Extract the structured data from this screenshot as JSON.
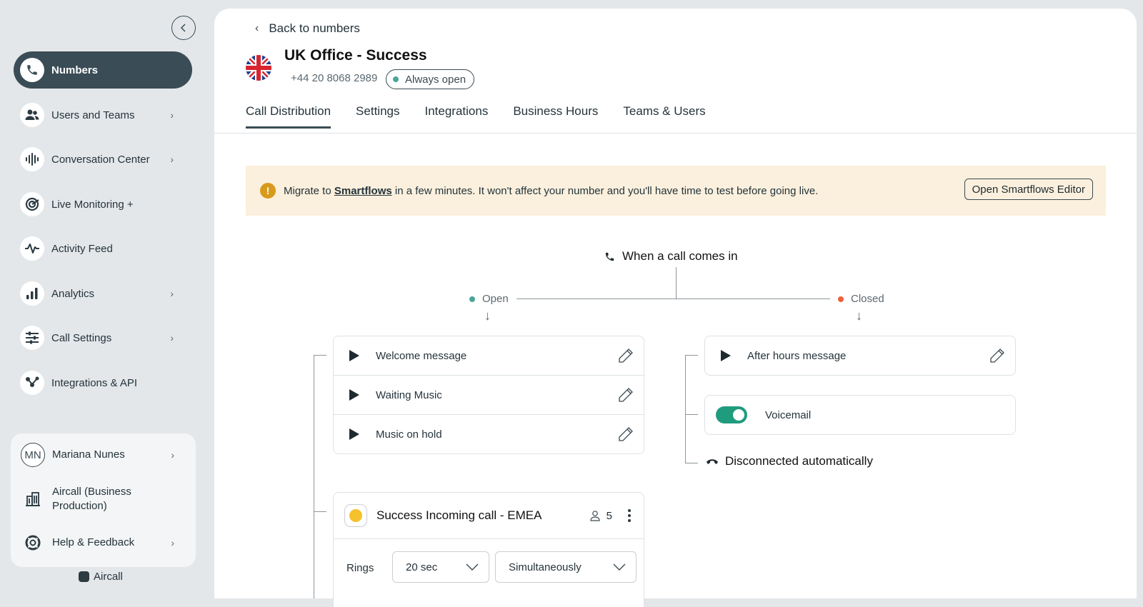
{
  "sidebar": {
    "items": [
      {
        "label": "Numbers",
        "icon": "phone-icon",
        "active": true
      },
      {
        "label": "Users and Teams",
        "icon": "users-icon",
        "chevron": true
      },
      {
        "label": "Conversation Center",
        "icon": "waveform-icon",
        "chevron": true
      },
      {
        "label": "Live Monitoring +",
        "icon": "live-monitoring-icon"
      },
      {
        "label": "Activity Feed",
        "icon": "activity-icon"
      },
      {
        "label": "Analytics",
        "icon": "bar-chart-icon",
        "chevron": true
      },
      {
        "label": "Call Settings",
        "icon": "sliders-icon",
        "chevron": true
      },
      {
        "label": "Integrations & API",
        "icon": "integrations-icon"
      }
    ],
    "account": {
      "user_initials": "MN",
      "user_name": "Mariana Nunes",
      "company_line1": "Aircall (Business",
      "company_line2": "Production)",
      "help": "Help & Feedback"
    },
    "brand": "Aircall"
  },
  "header": {
    "back_label": "Back to numbers",
    "title": "UK Office - Success",
    "phone": "+44 20 8068 2989",
    "status": "Always open",
    "status_color": "#4aa597"
  },
  "tabs": [
    "Call Distribution",
    "Settings",
    "Integrations",
    "Business Hours",
    "Teams & Users"
  ],
  "banner": {
    "text_before": "Migrate to ",
    "link": "Smartflows",
    "text_after": " in a few minutes. It won't affect your number and you'll have time to test before going live.",
    "button": "Open Smartflows Editor"
  },
  "flow": {
    "trigger": "When a call comes in",
    "open_label": "Open",
    "open_color": "#4aa597",
    "closed_label": "Closed",
    "closed_color": "#f0603a",
    "open_messages": [
      "Welcome message",
      "Waiting Music",
      "Music on hold"
    ],
    "closed_message": "After hours message",
    "voicemail": "Voicemail",
    "voicemail_enabled": true,
    "disconnect": "Disconnected automatically",
    "team": {
      "name": "Success Incoming call - EMEA",
      "members": "5",
      "rings_label": "Rings",
      "ring_duration": "20 sec",
      "ring_mode": "Simultaneously"
    }
  }
}
